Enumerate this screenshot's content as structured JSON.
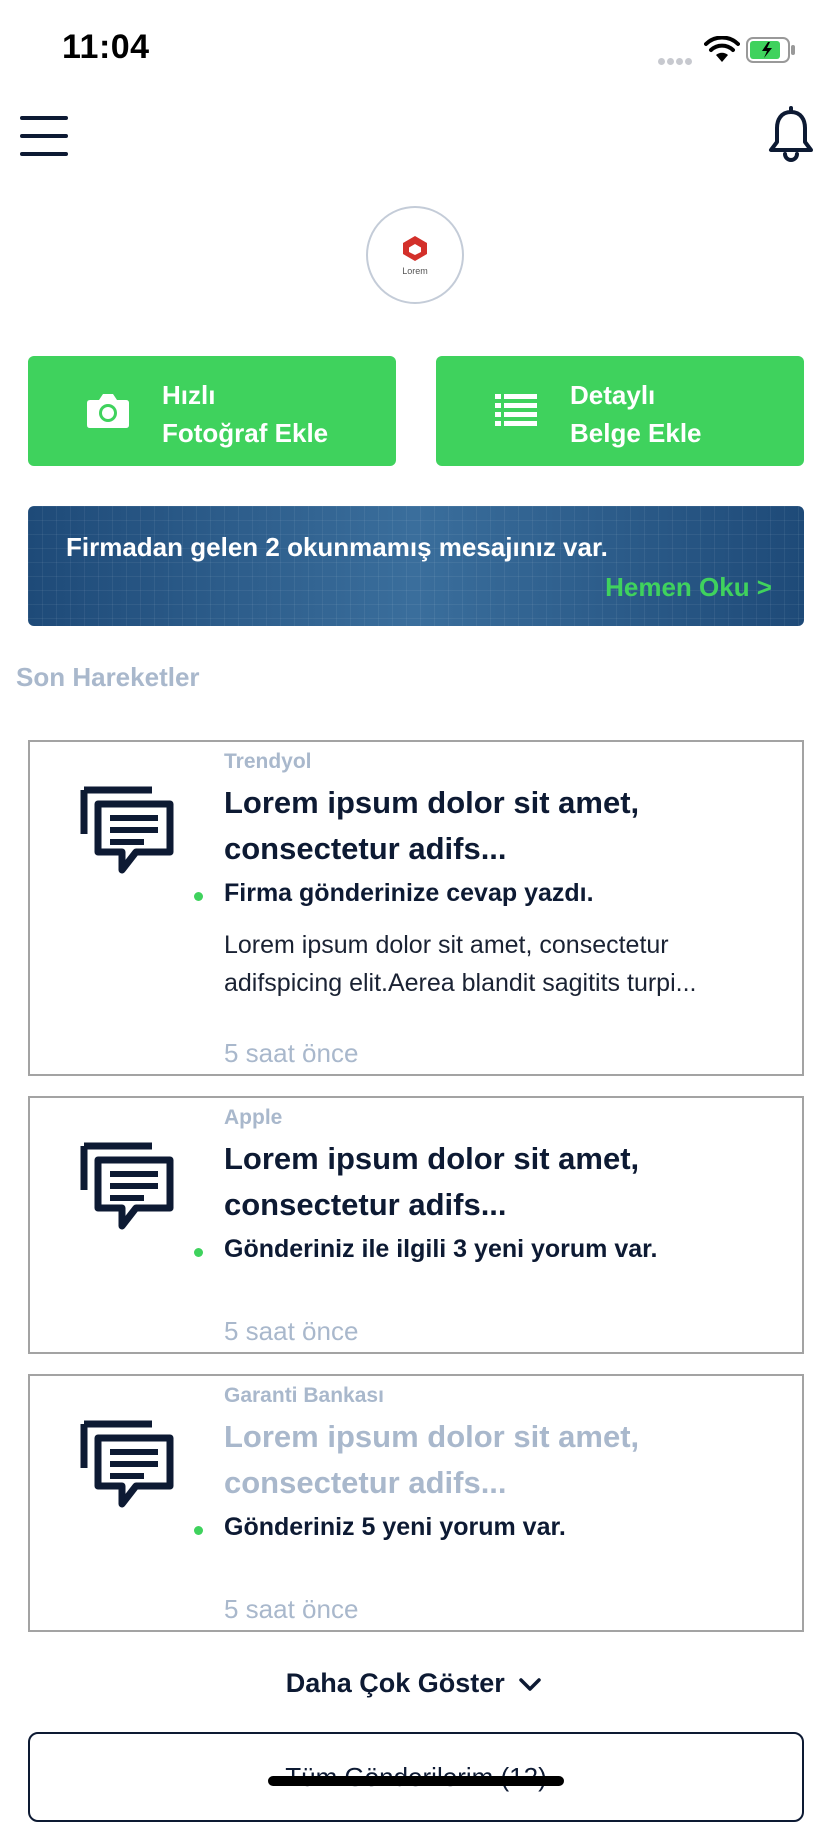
{
  "status_bar": {
    "time": "11:04"
  },
  "logo": {
    "text": "Lorem"
  },
  "actions": [
    {
      "line1": "Hızlı",
      "line2": "Fotoğraf Ekle",
      "icon": "camera-icon"
    },
    {
      "line1": "Detaylı",
      "line2": "Belge Ekle",
      "icon": "list-icon"
    }
  ],
  "banner": {
    "message": "Firmadan gelen 2 okunmamış mesajınız var.",
    "link": "Hemen Oku >"
  },
  "section_title": "Son Hareketler",
  "cards": [
    {
      "company": "Trendyol",
      "title": "Lorem ipsum dolor sit amet, consectetur adifs...",
      "status": "Firma gönderinize cevap yazdı.",
      "description": "Lorem ipsum dolor sit amet, consectetur adifspicing elit.Aerea blandit sagitits turpi...",
      "time": "5 saat önce"
    },
    {
      "company": "Apple",
      "title": "Lorem ipsum dolor sit amet, consectetur adifs...",
      "status": "Gönderiniz ile ilgili 3 yeni yorum var.",
      "time": "5 saat önce"
    },
    {
      "company": "Garanti Bankası",
      "title": "Lorem ipsum dolor sit amet, consectetur adifs...",
      "status": "Gönderiniz 5 yeni yorum var.",
      "time": "5 saat önce"
    }
  ],
  "show_more": "Daha Çok Göster",
  "all_posts": "Tüm Gönderilerim (12)",
  "colors": {
    "accent": "#3fd25d",
    "navy": "#0d1a33",
    "muted": "#a9b8cc"
  }
}
